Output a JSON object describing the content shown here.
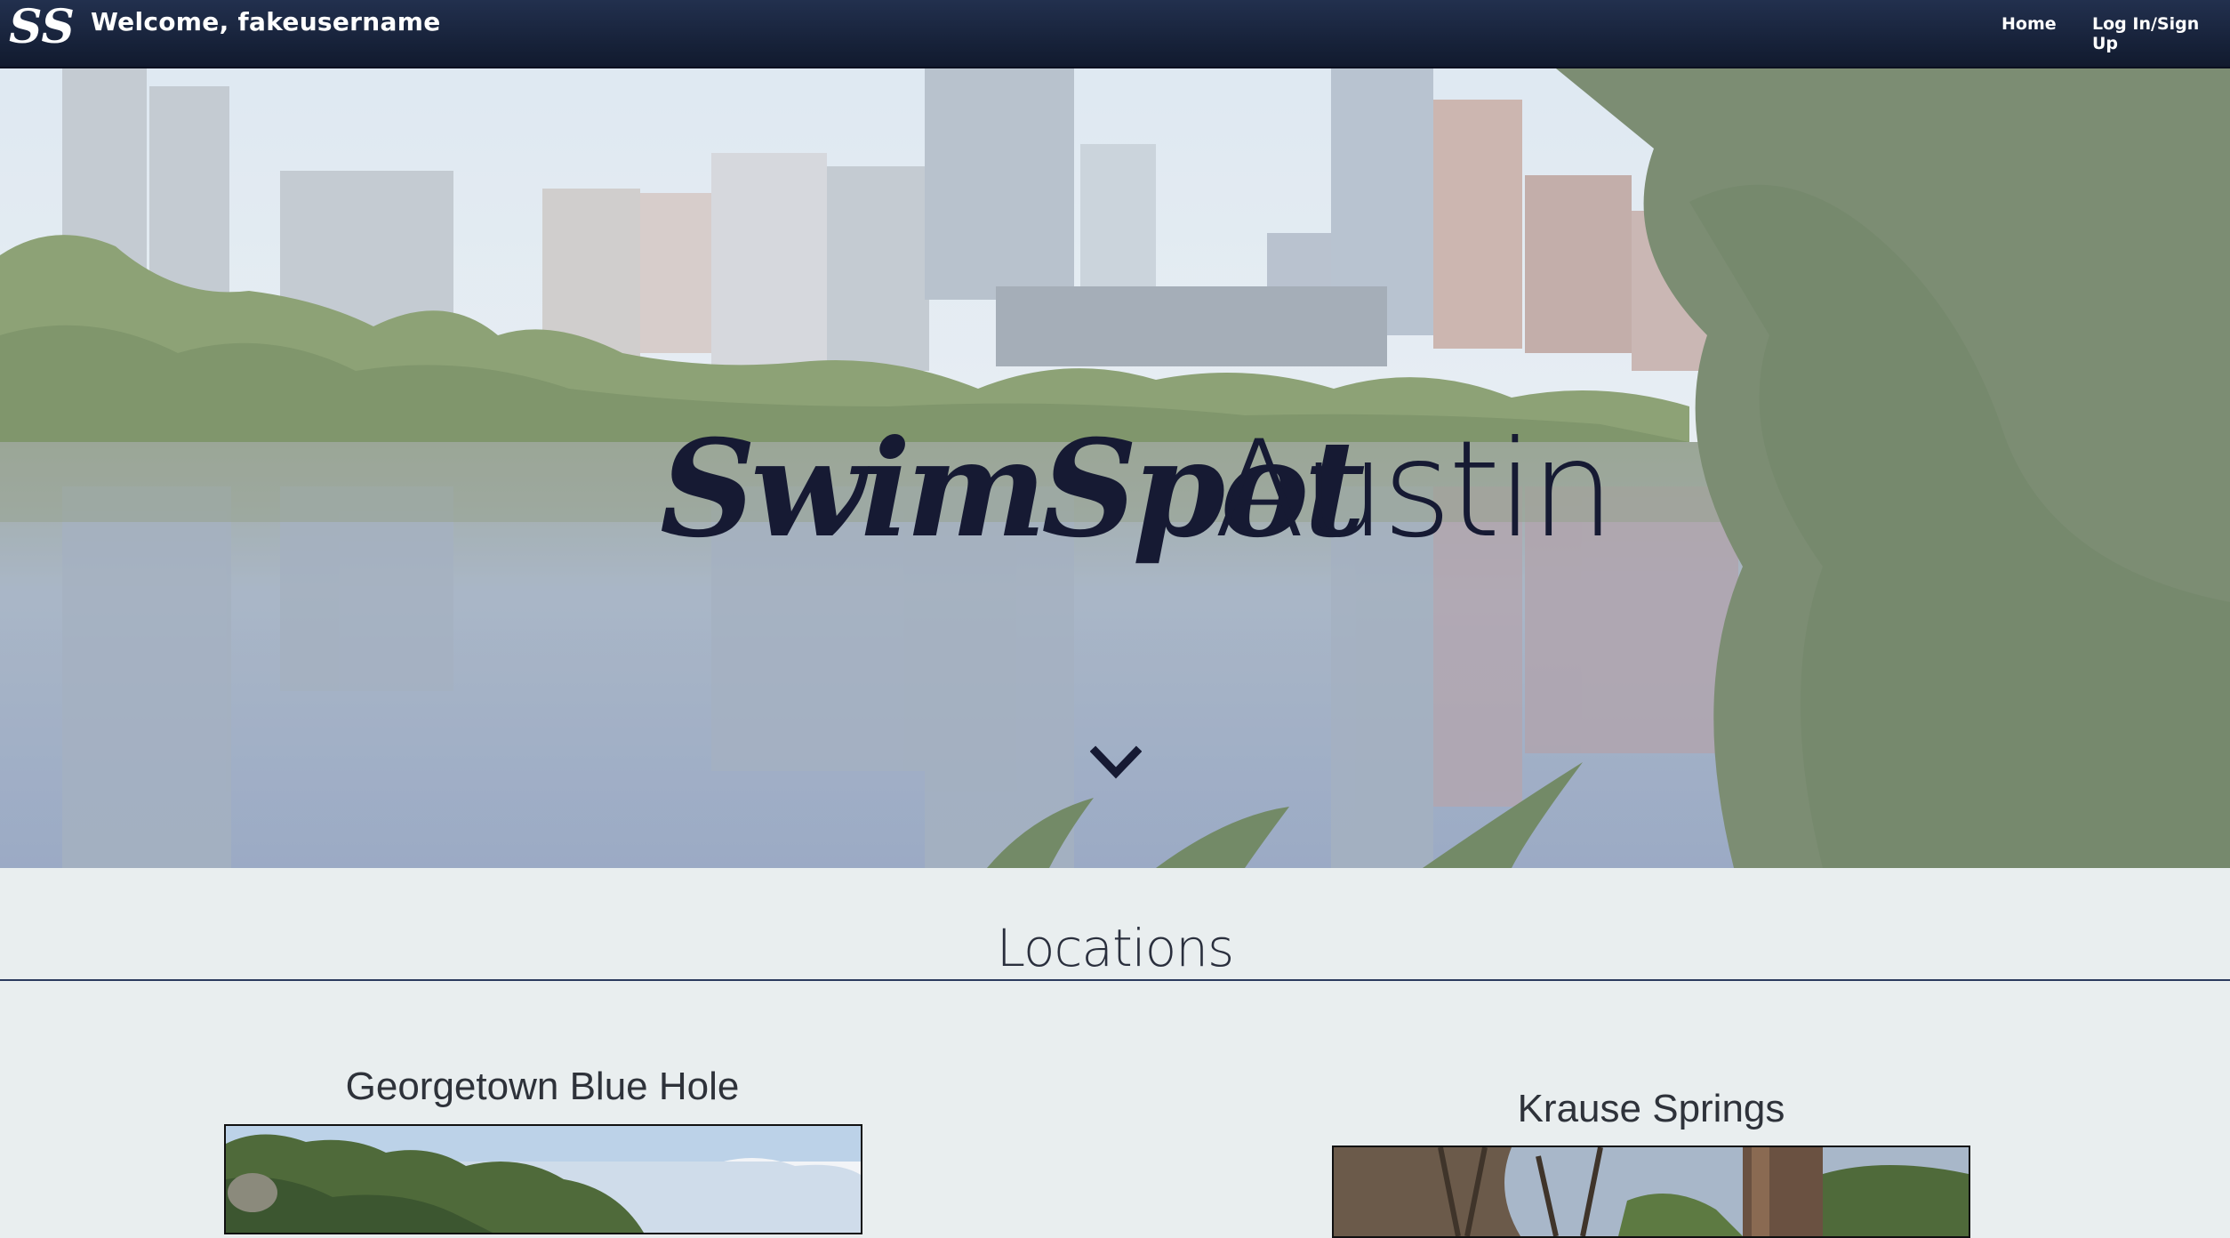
{
  "navbar": {
    "logo_text": "SS",
    "welcome": "Welcome, fakeusername",
    "links": [
      {
        "label": "Home"
      },
      {
        "label": "Log In/Sign Up"
      }
    ],
    "bg_color": "#1a2440"
  },
  "hero": {
    "brand_script": "SwimSpot",
    "brand_thin": "Austin",
    "brand_color": "#161a33",
    "scroll_icon": "chevron-down-icon"
  },
  "locations": {
    "heading": "Locations",
    "items": [
      {
        "name": "Georgetown Blue Hole"
      },
      {
        "name": "Krause Springs"
      }
    ]
  }
}
